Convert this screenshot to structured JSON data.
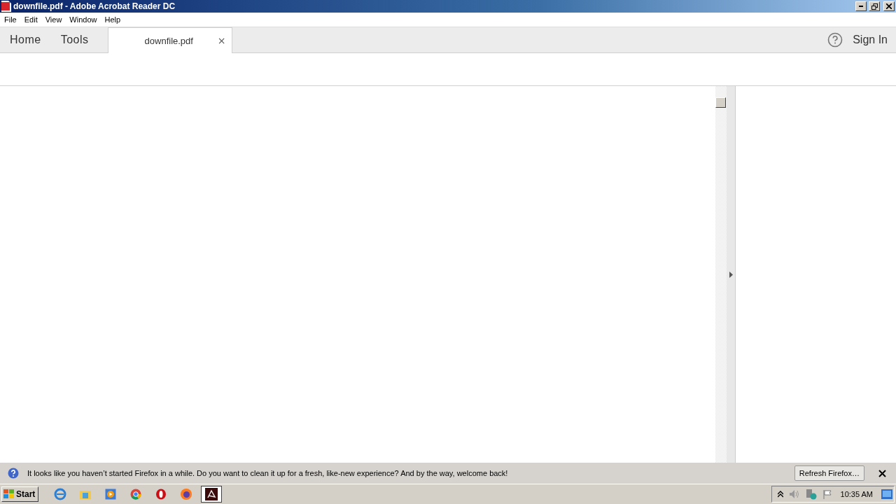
{
  "window": {
    "title": "downfile.pdf - Adobe Acrobat Reader DC"
  },
  "menu": [
    "File",
    "Edit",
    "View",
    "Window",
    "Help"
  ],
  "nav": [
    "Home",
    "Tools"
  ],
  "document_tab": {
    "label": "downfile.pdf",
    "close": "×",
    "selected": true
  },
  "sign_in": "Sign In",
  "notification": {
    "message": "It looks like you haven’t started Firefox in a while. Do you want to clean it up for a fresh, like-new experience? And by the way, welcome back!",
    "button": "Refresh Firefox…"
  },
  "taskbar": {
    "start": "Start",
    "apps": [
      {
        "kind": "ie",
        "selected": false
      },
      {
        "kind": "folder",
        "selected": false
      },
      {
        "kind": "media",
        "selected": false
      },
      {
        "kind": "chrome",
        "selected": false
      },
      {
        "kind": "opera",
        "selected": false
      },
      {
        "kind": "firefox",
        "selected": false
      },
      {
        "kind": "acrobat",
        "selected": true
      }
    ],
    "clock": "10:35 AM"
  }
}
